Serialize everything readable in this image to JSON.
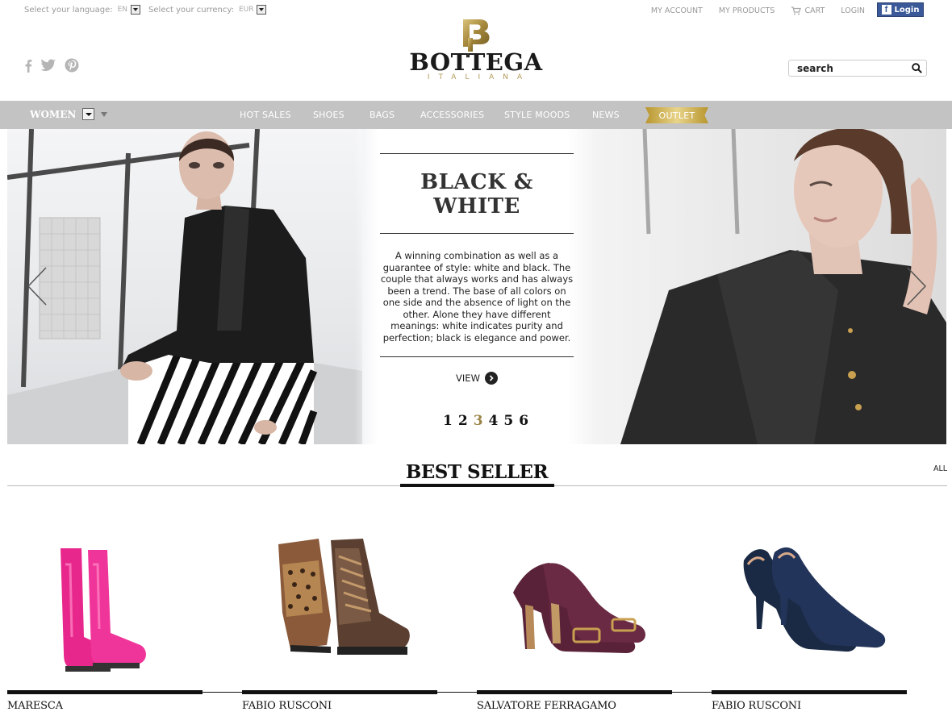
{
  "topbar": {
    "language_label": "Select your language:",
    "language_value": "EN",
    "currency_label": "Select your currency:",
    "currency_value": "EUR",
    "links": [
      "MY ACCOUNT",
      "MY PRODUCTS",
      "CART",
      "LOGIN"
    ],
    "facebook_login": "Login"
  },
  "logo": {
    "name": "BOTTEGA",
    "sub": "ITALIANA"
  },
  "search": {
    "placeholder": "search"
  },
  "nav": {
    "gender": "WOMEN",
    "items": [
      "HOT SALES",
      "SHOES",
      "BAGS",
      "ACCESSORIES",
      "STYLE MOODS",
      "NEWS"
    ],
    "outlet": "OUTLET"
  },
  "hero": {
    "title": "BLACK & WHITE",
    "description": "A winning combination as well as a guarantee of style: white and black. The couple that always works and has always been a trend. The base of all colors on one side and the absence of light on the other. Alone they have different meanings: white indicates purity and perfection; black is elegance and power.",
    "view_label": "VIEW",
    "pages": [
      "1",
      "2",
      "3",
      "4",
      "5",
      "6"
    ],
    "active_page": "3"
  },
  "bestseller": {
    "title": "BEST SELLER",
    "all_label": "ALL",
    "products": [
      {
        "brand": "MARESCA",
        "image": "pink-rain-boots"
      },
      {
        "brand": "FABIO RUSCONI",
        "image": "leopard-lace-up-sneakers"
      },
      {
        "brand": "SALVATORE FERRAGAMO",
        "image": "burgundy-pumps"
      },
      {
        "brand": "FABIO RUSCONI",
        "image": "navy-suede-pumps"
      }
    ]
  },
  "colors": {
    "nav_bg": "#c3c3c3",
    "gold": "#b29a5a",
    "facebook": "#3b5998",
    "active_page": "#9b8446"
  }
}
